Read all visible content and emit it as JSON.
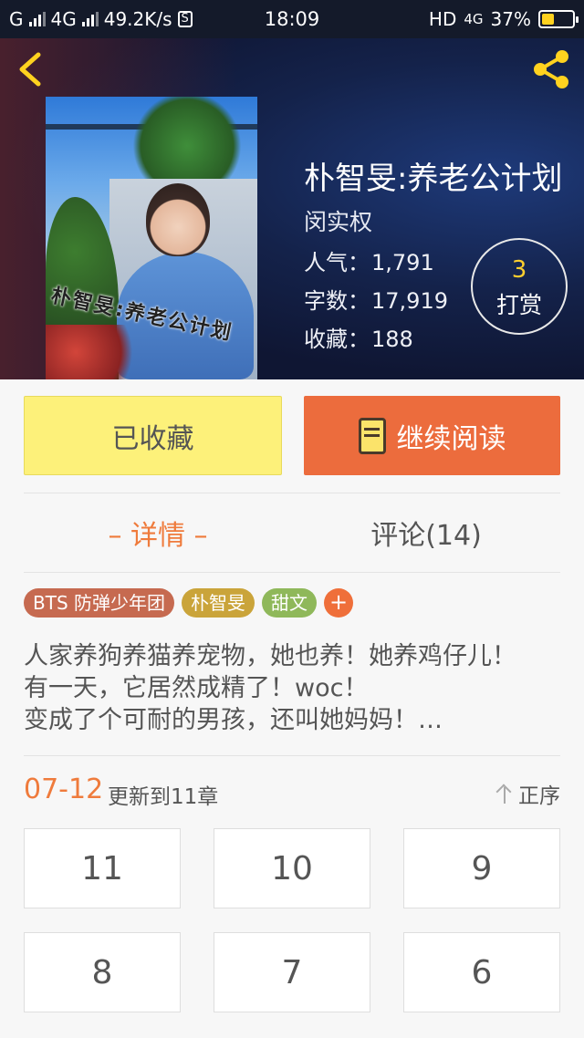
{
  "status_bar": {
    "carrier1": "G",
    "carrier2": "4G",
    "speed": "49.2K/s",
    "s_badge": "S",
    "time": "18:09",
    "network": "HD",
    "network2": "4G",
    "battery": "37%"
  },
  "book": {
    "title": "朴智旻:养老公计划",
    "author": "闵实权",
    "cover_text": "朴智旻:养老公计划",
    "stats": [
      {
        "label": "人气：",
        "value": "1,791"
      },
      {
        "label": "字数：",
        "value": "17,919"
      },
      {
        "label": "收藏：",
        "value": "188"
      }
    ],
    "reward": {
      "count": "3",
      "label": "打赏"
    }
  },
  "actions": {
    "favorited": "已收藏",
    "continue": "继续阅读"
  },
  "tabs": {
    "detail": "– 详情 –",
    "comments": "评论(14)"
  },
  "tags": [
    {
      "label": "BTS 防弹少年团",
      "color": "#c66a50"
    },
    {
      "label": "朴智旻",
      "color": "#caa43a"
    },
    {
      "label": "甜文",
      "color": "#8fb85a"
    }
  ],
  "tag_add": "+",
  "summary": [
    "人家养狗养猫养宠物，她也养！她养鸡仔儿！",
    "有一天，它居然成精了！woc！",
    "变成了个可耐的男孩，还叫她妈妈！…"
  ],
  "update": {
    "date": "07-12",
    "text": "更新到11章",
    "order": "正序"
  },
  "chapters": [
    "11",
    "10",
    "9",
    "8",
    "7",
    "6"
  ],
  "colors": {
    "accent": "#ef7b3c",
    "read_button": "#ec6c3d",
    "fav_button": "#fdf17a",
    "reward_number": "#ffcf2e"
  }
}
